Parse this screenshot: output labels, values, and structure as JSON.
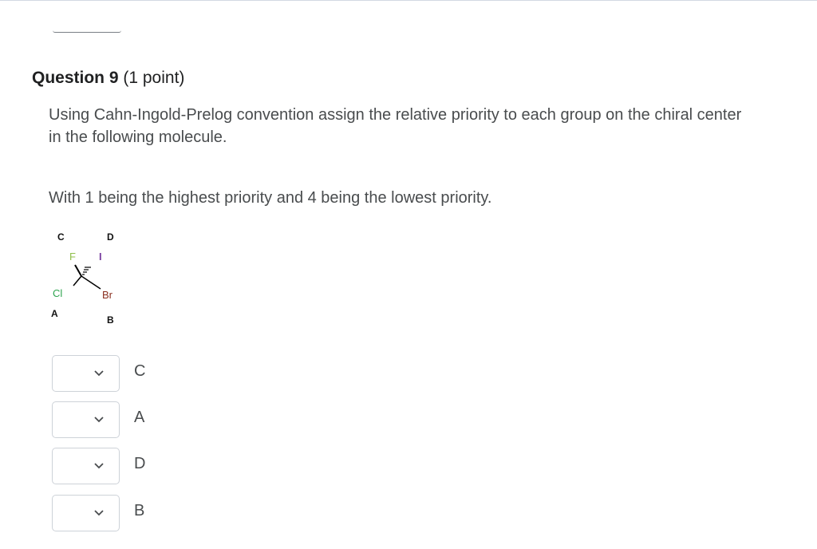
{
  "question": {
    "title": "Question 9",
    "points": "(1 point)",
    "prompt": "Using Cahn-Ingold-Prelog convention assign the relative priority to each group on the chiral center in the following molecule.",
    "instruction": "With 1 being the highest priority and 4 being the lowest priority."
  },
  "molecule": {
    "labels": {
      "c": "C",
      "d": "D",
      "a": "A",
      "b": "B"
    },
    "atoms": {
      "f": "F",
      "i": "I",
      "cl": "Cl",
      "br": "Br"
    },
    "colors": {
      "fluorine": "#8fbf4a",
      "chlorine": "#2ea44f",
      "iodine": "#7a3fa0",
      "bond": "#000000"
    }
  },
  "answers": [
    {
      "letter": "C",
      "selected": ""
    },
    {
      "letter": "A",
      "selected": ""
    },
    {
      "letter": "D",
      "selected": ""
    },
    {
      "letter": "B",
      "selected": ""
    }
  ]
}
